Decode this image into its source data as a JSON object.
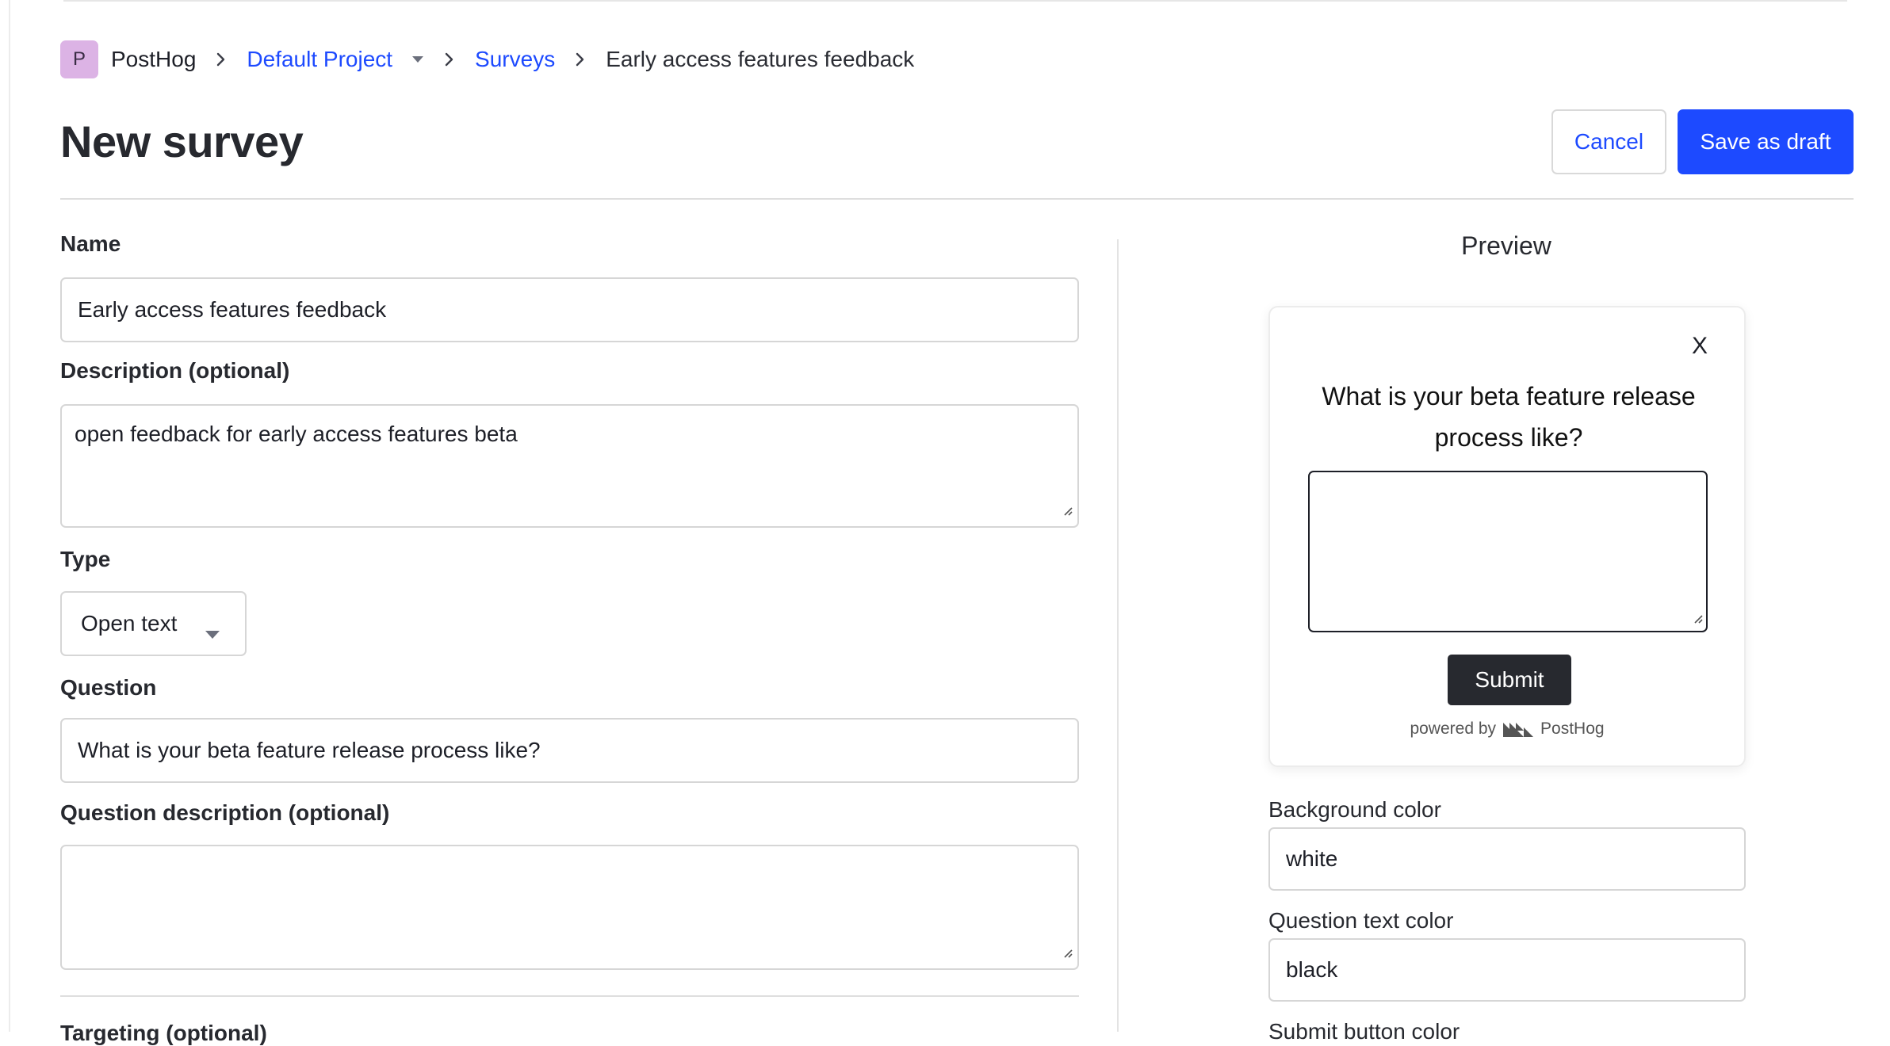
{
  "breadcrumb": {
    "org_initial": "P",
    "org": "PostHog",
    "project": "Default Project",
    "section": "Surveys",
    "current": "Early access features feedback"
  },
  "header": {
    "title": "New survey",
    "cancel_label": "Cancel",
    "save_label": "Save as draft"
  },
  "form": {
    "name_label": "Name",
    "name_value": "Early access features feedback",
    "description_label": "Description (optional)",
    "description_value": "open feedback for early access features beta",
    "type_label": "Type",
    "type_value": "Open text",
    "question_label": "Question",
    "question_value": "What is your beta feature release process like?",
    "question_description_label": "Question description (optional)",
    "question_description_value": "",
    "next_label_cut": "Targeting (optional)"
  },
  "preview": {
    "title": "Preview",
    "close_label": "X",
    "question": "What is your beta feature release process like?",
    "submit_label": "Submit",
    "powered_by": "powered by",
    "brand": "PostHog"
  },
  "appearance": {
    "background_color_label": "Background color",
    "background_color_value": "white",
    "question_text_color_label": "Question text color",
    "question_text_color_value": "black",
    "submit_button_color_label": "Submit button color"
  },
  "colors": {
    "primary": "#1d4aff",
    "avatar": "#dcb3e5",
    "submit_button": "#27292f"
  }
}
